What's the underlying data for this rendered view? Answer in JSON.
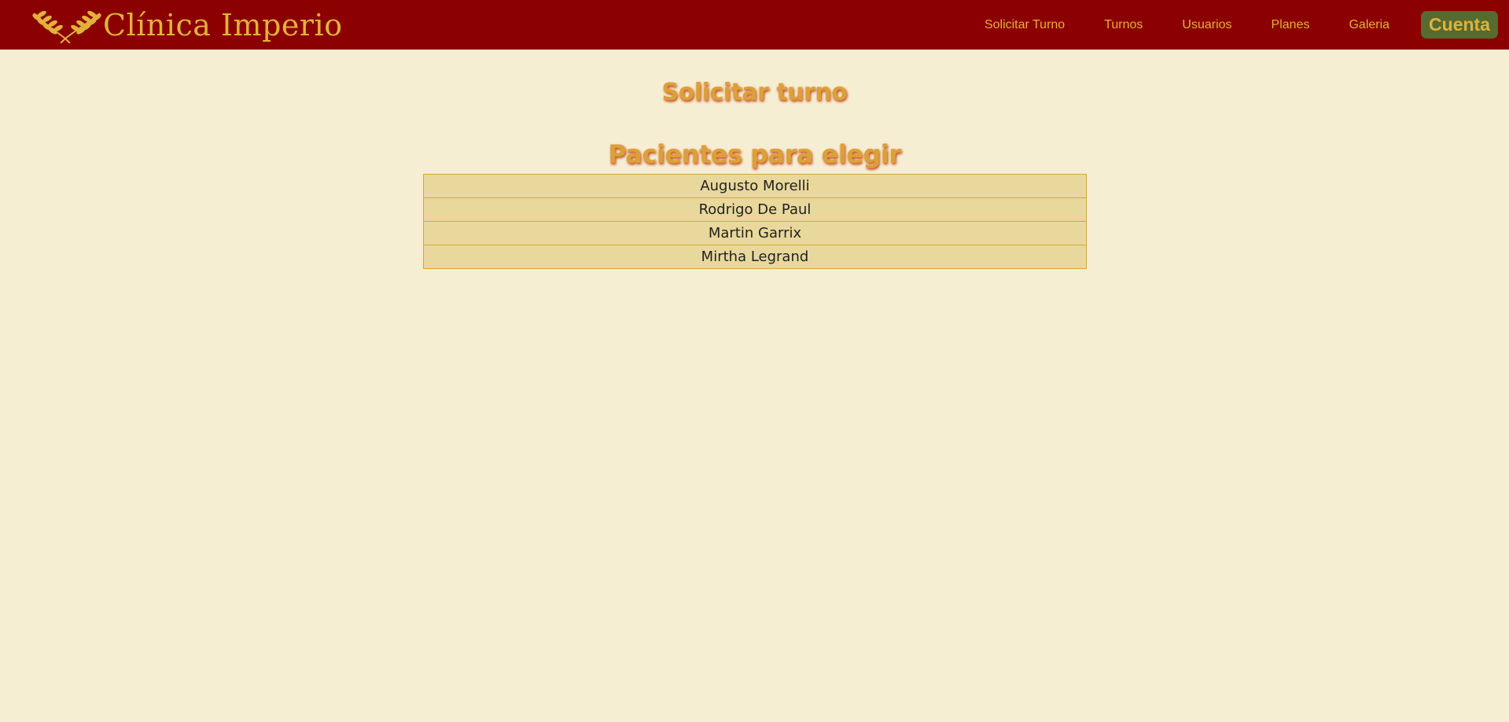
{
  "colors": {
    "navbar_bg": "#8b0000",
    "accent_gold": "#e2b13c",
    "title_color": "#dba03a",
    "account_button_bg": "#556b2f",
    "page_bg": "#f6eed3",
    "list_bg": "#e8d89c",
    "list_border": "#d4a935"
  },
  "header": {
    "brand": {
      "icon": "laurel-wreath-icon",
      "name": "Clínica Imperio"
    },
    "nav": {
      "solicitar_turno": "Solicitar Turno",
      "turnos": "Turnos",
      "usuarios": "Usuarios",
      "planes": "Planes",
      "galeria": "Galeria",
      "cuenta": "Cuenta"
    }
  },
  "main": {
    "title": "Solicitar turno",
    "patients_section": {
      "title": "Pacientes para elegir",
      "patients": [
        "Augusto Morelli",
        "Rodrigo De Paul",
        "Martin Garrix",
        "Mirtha Legrand"
      ]
    }
  }
}
